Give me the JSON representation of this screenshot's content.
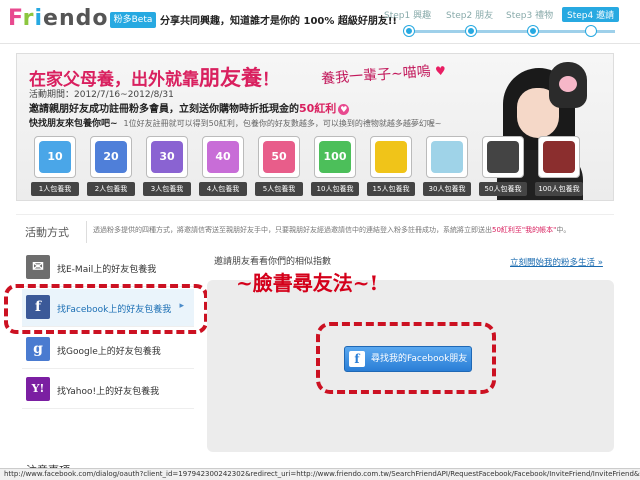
{
  "header": {
    "logo_text": "Friendo",
    "beta_badge": "粉多Beta",
    "tagline": "分享共同興趣，知道誰才是你的 100% 超級好朋友!!",
    "steps": [
      {
        "label": "Step1 興趣",
        "active": false
      },
      {
        "label": "Step2 朋友",
        "active": false
      },
      {
        "label": "Step3 禮物",
        "active": false
      },
      {
        "label": "Step4 邀請",
        "active": true
      }
    ]
  },
  "banner": {
    "title_pre": "在家父母養，出外就靠",
    "title_big": "朋友養",
    "title_post": "！",
    "meow": "養我一輩子~喵嗚",
    "period": "活動期間：2012/7/16~2012/8/31",
    "offer_pre": "邀請親朋好友成功註冊粉多會員，立刻送你購物時折抵現金的",
    "offer_points": "50紅利",
    "sub_bold": "快找朋友來包養你吧~",
    "sub_small": "1位好友註冊就可以得到50紅利，包養你的好友數越多，可以換到的禮物就越多越夢幻喔~",
    "rewards": [
      {
        "label": "1人包養我",
        "tile": "10",
        "color": "#4aa6e8"
      },
      {
        "label": "2人包養我",
        "tile": "20",
        "color": "#4f7fd9"
      },
      {
        "label": "3人包養我",
        "tile": "30",
        "color": "#8a63d2"
      },
      {
        "label": "4人包養我",
        "tile": "40",
        "color": "#c86dd7"
      },
      {
        "label": "5人包養我",
        "tile": "50",
        "color": "#e85d8a"
      },
      {
        "label": "10人包養我",
        "tile": "100",
        "color": "#4cbf5a"
      },
      {
        "label": "15人包養我",
        "tile": "",
        "color": "#f0c419"
      },
      {
        "label": "30人包養我",
        "tile": "",
        "color": "#9fd3e8"
      },
      {
        "label": "50人包養我",
        "tile": "",
        "color": "#444444"
      },
      {
        "label": "100人包養我",
        "tile": "",
        "color": "#8b2e2e"
      }
    ]
  },
  "method": {
    "label": "活動方式",
    "desc_pre": "透過粉多提供的四種方式，將邀請信寄送至親朋好友手中，只要親朋好友經過邀請信中的連結登入粉多註冊成功，系統將立即送出",
    "desc_red": "50紅利至\"我的帳本\"",
    "desc_post": "中。"
  },
  "sidebar": {
    "items": [
      {
        "label": "找E-Mail上的好友包養我",
        "icon": "✉",
        "color": "#6d6d6d"
      },
      {
        "label": "找Facebook上的好友包養我",
        "icon": "f",
        "color": "#3b5998"
      },
      {
        "label": "找Google上的好友包養我",
        "icon": "g",
        "color": "#4a7bd0"
      },
      {
        "label": "找Yahoo!上的好友包養我",
        "icon": "Y!",
        "color": "#7b1fa2"
      }
    ],
    "active_arrow": "▸"
  },
  "panel": {
    "title": "邀請朋友看看你們的相似指數",
    "link": "立刻開始我的粉多生活 »",
    "annotation": "~臉書尋友法~!",
    "fb_button": "尋找我的Facebook朋友"
  },
  "footer_text": "注意事項",
  "statusbar": "http://www.facebook.com/dialog/oauth?client_id=197942300242302&redirect_uri=http://www.friendo.com.tw/SearchFriendAPI/RequestFacebook/Facebook/InviteFriend/InviteFriend&scope=publish_stream,offline_access"
}
